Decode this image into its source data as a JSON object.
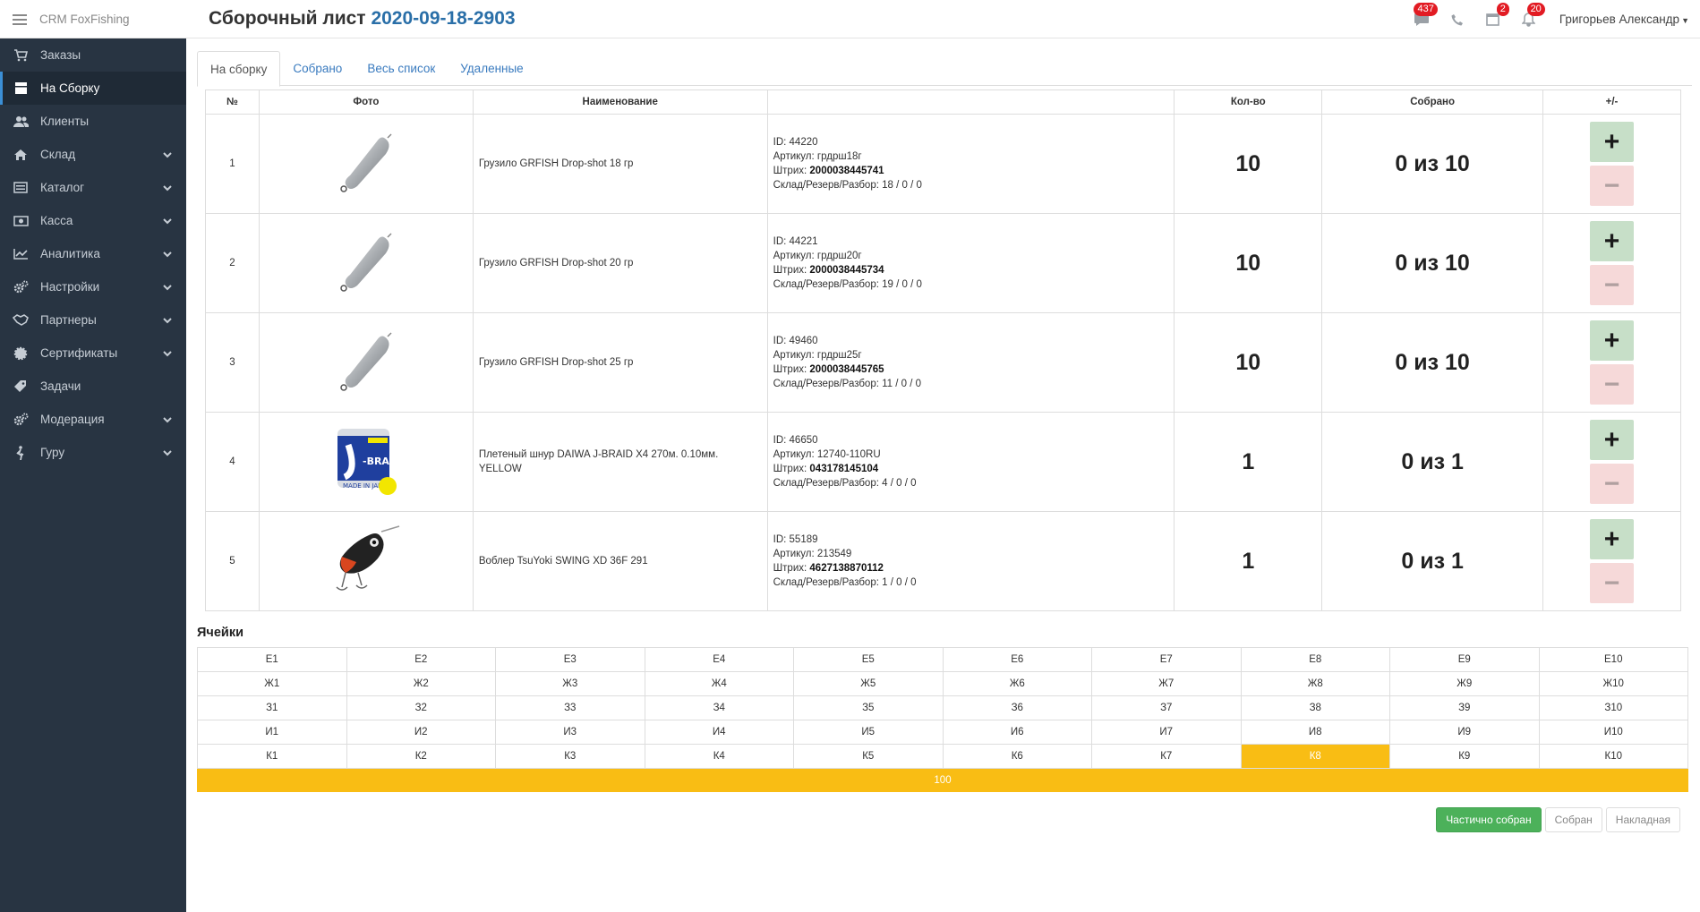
{
  "app": {
    "brand": "CRM FoxFishing"
  },
  "header": {
    "title_prefix": "Сборочный лист",
    "doc_number": "2020-09-18-2903",
    "badges": {
      "messages": "437",
      "tasks": "2",
      "notifications": "20"
    },
    "user": "Григорьев Александр"
  },
  "sidebar": {
    "items": [
      {
        "label": "Заказы",
        "icon": "cart-icon"
      },
      {
        "label": "На Сборку",
        "icon": "box-icon",
        "active": true
      },
      {
        "label": "Клиенты",
        "icon": "users-icon"
      },
      {
        "label": "Склад",
        "icon": "home-icon",
        "expandable": true
      },
      {
        "label": "Каталог",
        "icon": "catalog-icon",
        "expandable": true
      },
      {
        "label": "Касса",
        "icon": "money-icon",
        "expandable": true
      },
      {
        "label": "Аналитика",
        "icon": "chart-icon",
        "expandable": true
      },
      {
        "label": "Настройки",
        "icon": "gears-icon",
        "expandable": true
      },
      {
        "label": "Партнеры",
        "icon": "handshake-icon",
        "expandable": true
      },
      {
        "label": "Сертификаты",
        "icon": "certificate-icon",
        "expandable": true
      },
      {
        "label": "Задачи",
        "icon": "tag-icon"
      },
      {
        "label": "Модерация",
        "icon": "gears-icon",
        "expandable": true
      },
      {
        "label": "Гуру",
        "icon": "walking-icon",
        "expandable": true
      }
    ]
  },
  "tabs": [
    "На сборку",
    "Собрано",
    "Весь список",
    "Удаленные"
  ],
  "table": {
    "headers": {
      "num": "№",
      "photo": "Фото",
      "name": "Наименование",
      "info": "",
      "qty": "Кол-во",
      "collected": "Собрано",
      "ctrl": "+/-"
    },
    "plus": "+",
    "minus": "−",
    "rows": [
      {
        "num": "1",
        "name": "Грузило GRFISH Drop-shot 18 гр",
        "id_label": "ID:",
        "id": "44220",
        "article_label": "Артикул:",
        "article": "грдрш18г",
        "barcode_label": "Штрих:",
        "barcode": "2000038445741",
        "stock_label": "Склад/Резерв/Разбор:",
        "stock": "18 / 0 / 0",
        "qty": "10",
        "collected": "0 из 10",
        "photo": "sinker"
      },
      {
        "num": "2",
        "name": "Грузило GRFISH Drop-shot 20 гр",
        "id_label": "ID:",
        "id": "44221",
        "article_label": "Артикул:",
        "article": "грдрш20г",
        "barcode_label": "Штрих:",
        "barcode": "2000038445734",
        "stock_label": "Склад/Резерв/Разбор:",
        "stock": "19 / 0 / 0",
        "qty": "10",
        "collected": "0 из 10",
        "photo": "sinker"
      },
      {
        "num": "3",
        "name": "Грузило GRFISH Drop-shot 25 гр",
        "id_label": "ID:",
        "id": "49460",
        "article_label": "Артикул:",
        "article": "грдрш25г",
        "barcode_label": "Штрих:",
        "barcode": "2000038445765",
        "stock_label": "Склад/Резерв/Разбор:",
        "stock": "11 / 0 / 0",
        "qty": "10",
        "collected": "0 из 10",
        "photo": "sinker"
      },
      {
        "num": "4",
        "name": "Плетеный шнур DAIWA J-BRAID X4 270м. 0.10мм. YELLOW",
        "id_label": "ID:",
        "id": "46650",
        "article_label": "Артикул:",
        "article": "12740-110RU",
        "barcode_label": "Штрих:",
        "barcode": "043178145104",
        "stock_label": "Склад/Резерв/Разбор:",
        "stock": "4 / 0 / 0",
        "qty": "1",
        "collected": "0 из 1",
        "photo": "braid"
      },
      {
        "num": "5",
        "name": "Воблер TsuYoki SWING XD 36F 291",
        "id_label": "ID:",
        "id": "55189",
        "article_label": "Артикул:",
        "article": "213549",
        "barcode_label": "Штрих:",
        "barcode": "4627138870112",
        "stock_label": "Склад/Резерв/Разбор:",
        "stock": "1 / 0 / 0",
        "qty": "1",
        "collected": "0 из 1",
        "photo": "wobbler"
      }
    ]
  },
  "cells": {
    "title": "Ячейки",
    "rows": [
      [
        "Е1",
        "Е2",
        "Е3",
        "Е4",
        "Е5",
        "Е6",
        "Е7",
        "Е8",
        "Е9",
        "Е10"
      ],
      [
        "Ж1",
        "Ж2",
        "Ж3",
        "Ж4",
        "Ж5",
        "Ж6",
        "Ж7",
        "Ж8",
        "Ж9",
        "Ж10"
      ],
      [
        "З1",
        "З2",
        "З3",
        "З4",
        "З5",
        "З6",
        "З7",
        "З8",
        "З9",
        "З10"
      ],
      [
        "И1",
        "И2",
        "И3",
        "И4",
        "И5",
        "И6",
        "И7",
        "И8",
        "И9",
        "И10"
      ],
      [
        "К1",
        "К2",
        "К3",
        "К4",
        "К5",
        "К6",
        "К7",
        "К8",
        "К9",
        "К10"
      ]
    ],
    "highlighted": "К8",
    "bar_label": "100",
    "highlight_color": "#f9bd14"
  },
  "actions": {
    "partial": "Частично собран",
    "collected": "Собран",
    "invoice": "Накладная"
  }
}
